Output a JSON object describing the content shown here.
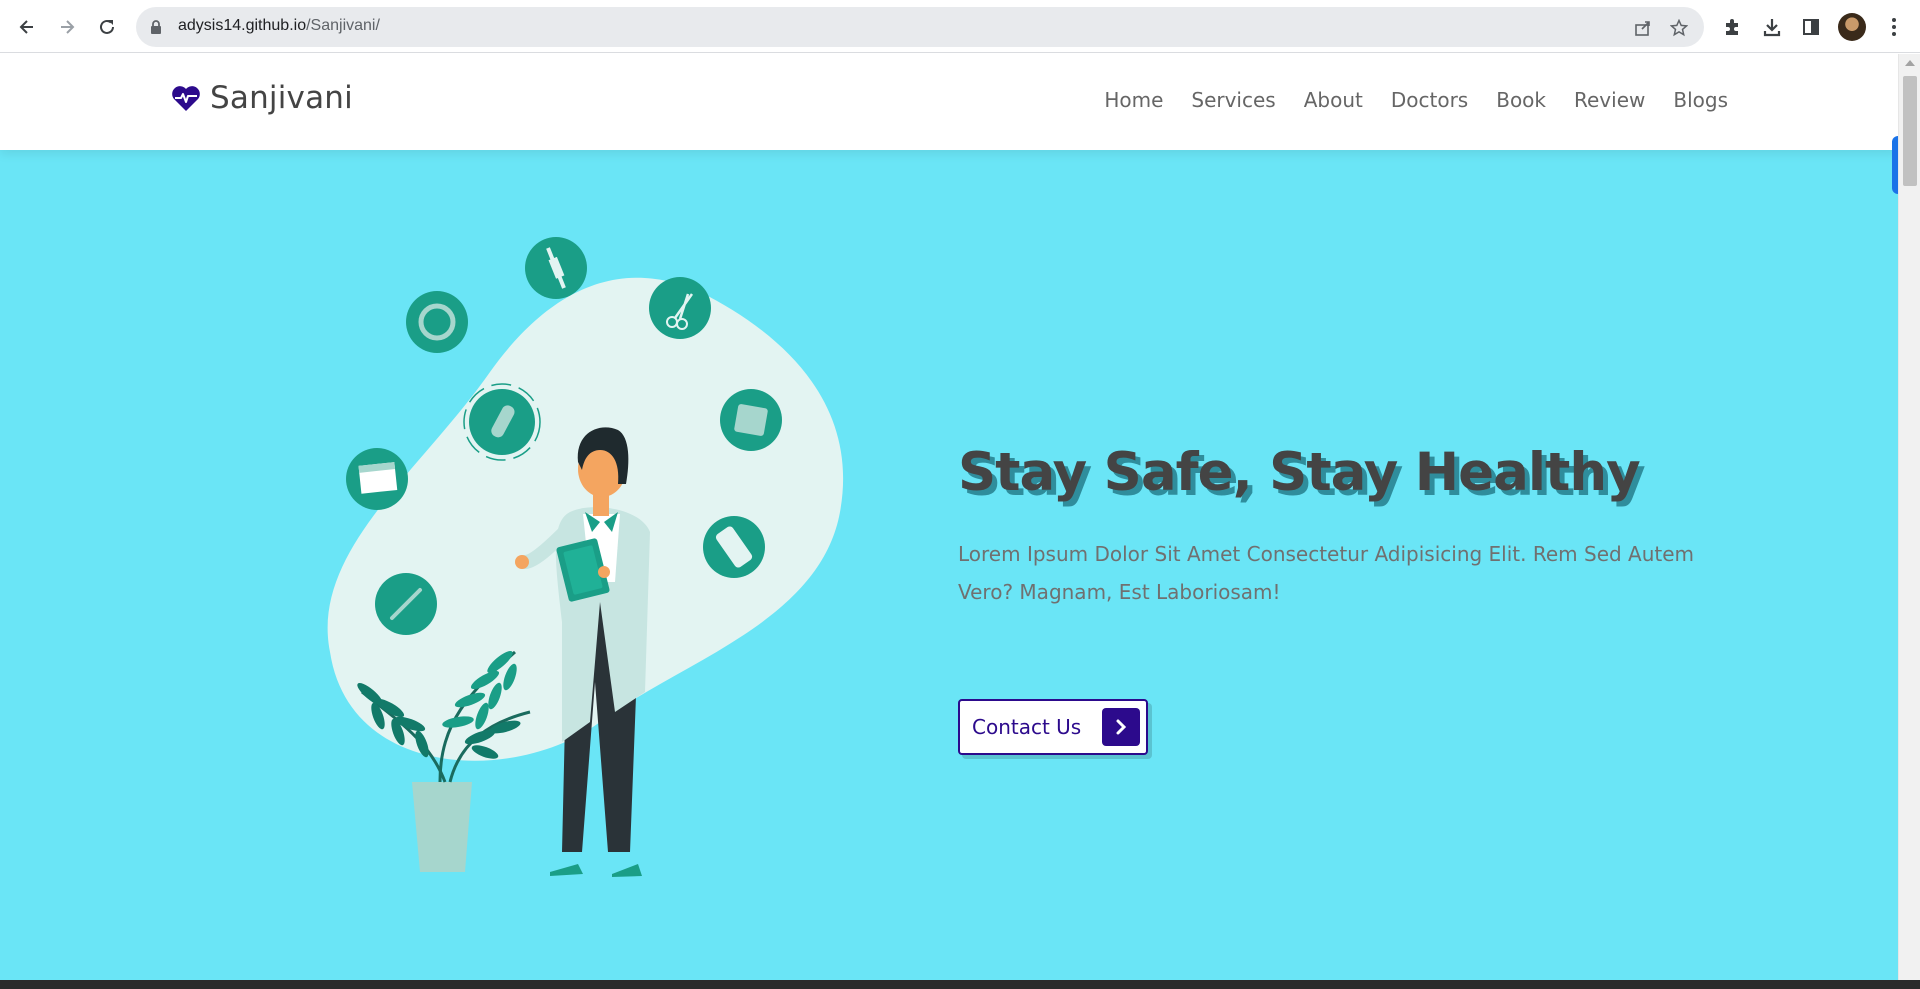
{
  "browser": {
    "url_host": "adysis14.github.io",
    "url_path": "/Sanjivani/",
    "icons": [
      "back-icon",
      "forward-icon",
      "reload-icon",
      "lock-icon",
      "share-icon",
      "star-icon",
      "extensions-icon",
      "download-icon",
      "side-panel-icon",
      "avatar",
      "more-icon"
    ]
  },
  "site": {
    "brand": "Sanjivani",
    "brand_icon": "heartbeat-icon",
    "nav": [
      "Home",
      "Services",
      "About",
      "Doctors",
      "Book",
      "Review",
      "Blogs"
    ]
  },
  "hero": {
    "title": "Stay Safe, Stay Healthy",
    "subtitle": "Lorem Ipsum Dolor Sit Amet Consectetur Adipisicing Elit. Rem Sed Autem Vero? Magnam, Est Laboriosam!",
    "cta_label": "Contact Us",
    "cta_icon": "chevron-right-icon",
    "illustration_icons": [
      "syringe-icon",
      "scissors-icon",
      "ring-icon",
      "bandage-icon",
      "calendar-icon",
      "pill-box-icon",
      "thermometer-icon",
      "pills-icon"
    ]
  },
  "colors": {
    "hero_bg": "#6ae5f6",
    "brand_purple": "#2c0a8c",
    "accent_teal": "#1a9e87",
    "title_shadow": "#2f8d9c"
  }
}
